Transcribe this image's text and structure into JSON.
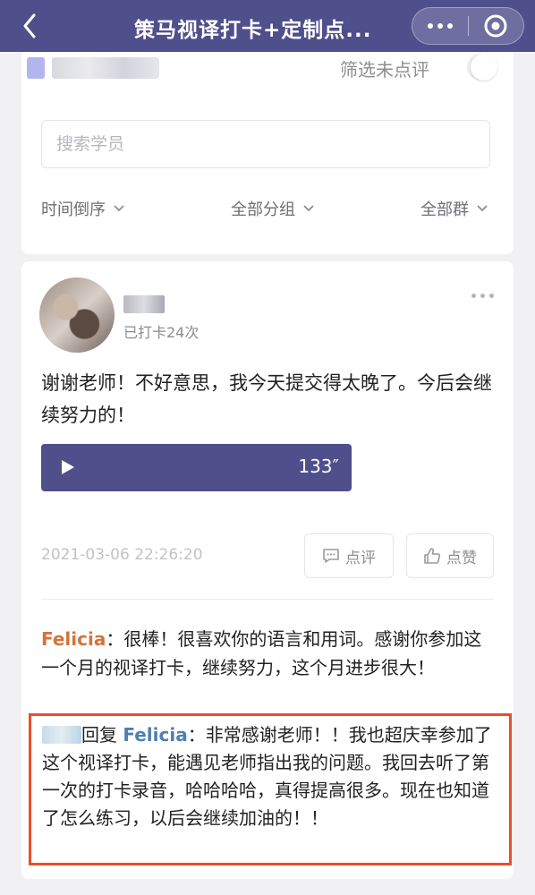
{
  "header": {
    "title": "策马视译打卡+定制点..."
  },
  "filter": {
    "toggle_label": "筛选未点评",
    "search_placeholder": "搜索学员",
    "dropdowns": [
      "时间倒序",
      "全部分组",
      "全部群"
    ]
  },
  "post": {
    "checkin_count": "已打卡24次",
    "text": "谢谢老师！不好意思，我今天提交得太晚了。今后会继续努力的！",
    "audio_duration": "133″",
    "timestamp": "2021-03-06 22:26:20",
    "comment_button": "点评",
    "like_button": "点赞"
  },
  "comment": {
    "author": "Felicia",
    "separator": "：",
    "text": "很棒！很喜欢你的语言和用词。感谢你参加这一个月的视译打卡，继续努力，这个月进步很大！"
  },
  "reply": {
    "reply_word": "回复",
    "target": "Felicia",
    "separator": "：",
    "text": "非常感谢老师！！我也超庆幸参加了这个视译打卡，能遇见老师指出我的问题。我回去听了第一次的打卡录音，哈哈哈哈，真得提高很多。现在也知道了怎么练习，以后会继续加油的！！"
  },
  "colors": {
    "brand": "#4f4f8c",
    "comment_author": "#d2743b",
    "reply_target": "#4d7fb2",
    "highlight_border": "#ec4d2a"
  }
}
